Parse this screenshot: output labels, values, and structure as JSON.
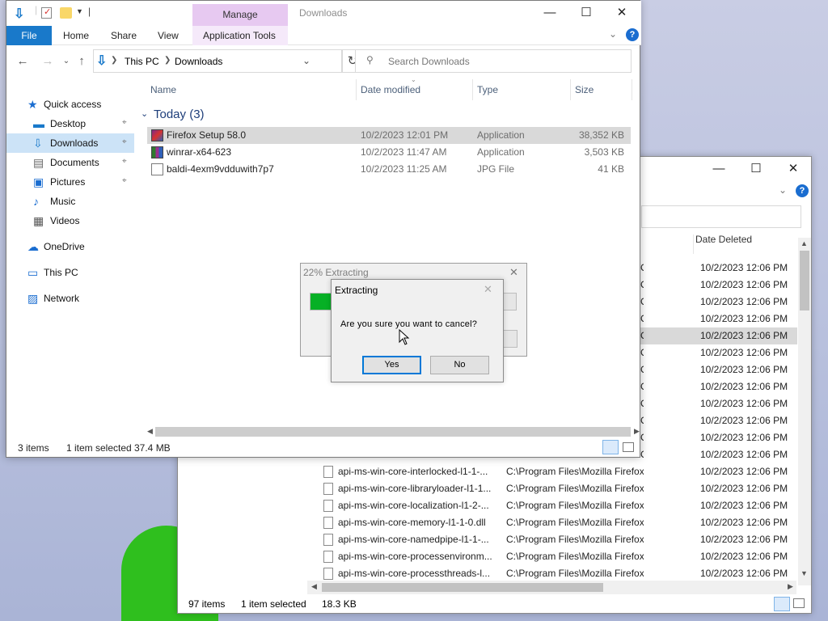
{
  "background_window": {
    "column_date_deleted": "Date Deleted",
    "status": {
      "count": "97 items",
      "selection": "1 item selected",
      "size": "18.3 KB"
    },
    "rows": [
      {
        "name": "",
        "path": "C:\\Program Files\\Mozilla Firefox",
        "date": "10/2/2023 12:06 PM"
      },
      {
        "name": "",
        "path": "C:\\Program Files\\Mozilla Firefox",
        "date": "10/2/2023 12:06 PM"
      },
      {
        "name": "",
        "path": "C:\\Program Files\\Mozilla Firefox",
        "date": "10/2/2023 12:06 PM"
      },
      {
        "name": "",
        "path": "C:\\Program Files\\Mozilla Firefox",
        "date": "10/2/2023 12:06 PM"
      },
      {
        "name": "",
        "path": "C:\\Program Files\\Mozilla Firefox",
        "date": "10/2/2023 12:06 PM"
      },
      {
        "name": "",
        "path": "C:\\Program Files\\Mozilla Firefox",
        "date": "10/2/2023 12:06 PM"
      },
      {
        "name": "",
        "path": "C:\\Program Files\\Mozilla Firefox",
        "date": "10/2/2023 12:06 PM"
      },
      {
        "name": "",
        "path": "C:\\Program Files\\Mozilla Firefox",
        "date": "10/2/2023 12:06 PM"
      },
      {
        "name": "",
        "path": "C:\\Program Files\\Mozilla Firefox",
        "date": "10/2/2023 12:06 PM"
      },
      {
        "name": "",
        "path": "C:\\Program Files\\Mozilla Firefox",
        "date": "10/2/2023 12:06 PM"
      },
      {
        "name": "",
        "path": "C:\\Program Files\\Mozilla Firefox",
        "date": "10/2/2023 12:06 PM"
      },
      {
        "name": "",
        "path": "C:\\Program Files\\Mozilla Firefox",
        "date": "10/2/2023 12:06 PM"
      },
      {
        "name": "api-ms-win-core-interlocked-l1-1-...",
        "path": "C:\\Program Files\\Mozilla Firefox",
        "date": "10/2/2023 12:06 PM"
      },
      {
        "name": "api-ms-win-core-libraryloader-l1-1...",
        "path": "C:\\Program Files\\Mozilla Firefox",
        "date": "10/2/2023 12:06 PM"
      },
      {
        "name": "api-ms-win-core-localization-l1-2-...",
        "path": "C:\\Program Files\\Mozilla Firefox",
        "date": "10/2/2023 12:06 PM"
      },
      {
        "name": "api-ms-win-core-memory-l1-1-0.dll",
        "path": "C:\\Program Files\\Mozilla Firefox",
        "date": "10/2/2023 12:06 PM"
      },
      {
        "name": "api-ms-win-core-namedpipe-l1-1-...",
        "path": "C:\\Program Files\\Mozilla Firefox",
        "date": "10/2/2023 12:06 PM"
      },
      {
        "name": "api-ms-win-core-processenvironm...",
        "path": "C:\\Program Files\\Mozilla Firefox",
        "date": "10/2/2023 12:06 PM"
      },
      {
        "name": "api-ms-win-core-processthreads-l...",
        "path": "C:\\Program Files\\Mozilla Firefox",
        "date": "10/2/2023 12:06 PM"
      }
    ]
  },
  "window": {
    "title": "Downloads",
    "manage_tab": "Manage",
    "ribbon": {
      "file": "File",
      "home": "Home",
      "share": "Share",
      "view": "View",
      "app_tools": "Application Tools"
    },
    "breadcrumb": {
      "this_pc": "This PC",
      "downloads": "Downloads"
    },
    "search_placeholder": "Search Downloads",
    "columns": {
      "name": "Name",
      "date": "Date modified",
      "type": "Type",
      "size": "Size"
    },
    "group": "Today (3)",
    "files": [
      {
        "name": "Firefox Setup 58.0",
        "date": "10/2/2023 12:01 PM",
        "type": "Application",
        "size": "38,352 KB",
        "icon": "firefox-installer-icon"
      },
      {
        "name": "winrar-x64-623",
        "date": "10/2/2023 11:47 AM",
        "type": "Application",
        "size": "3,503 KB",
        "icon": "winrar-icon"
      },
      {
        "name": "baldi-4exm9vdduwith7p7",
        "date": "10/2/2023 11:25 AM",
        "type": "JPG File",
        "size": "41 KB",
        "icon": "image-file-icon"
      }
    ],
    "nav": [
      {
        "label": "Quick access",
        "pinned": false
      },
      {
        "label": "Desktop",
        "pinned": true
      },
      {
        "label": "Downloads",
        "pinned": true
      },
      {
        "label": "Documents",
        "pinned": true
      },
      {
        "label": "Pictures",
        "pinned": true
      },
      {
        "label": "Music",
        "pinned": false
      },
      {
        "label": "Videos",
        "pinned": false
      },
      {
        "label": "OneDrive",
        "pinned": false
      },
      {
        "label": "This PC",
        "pinned": false
      },
      {
        "label": "Network",
        "pinned": false
      }
    ],
    "status": {
      "count": "3 items",
      "selection": "1 item selected",
      "size": "37.4 MB"
    }
  },
  "progress_dialog": {
    "title": "22% Extracting",
    "progress": 0.22
  },
  "confirm_dialog": {
    "title": "Extracting",
    "message": "Are you sure you want to cancel?",
    "yes": "Yes",
    "no": "No"
  },
  "colors": {
    "accent": "#1979ca",
    "manage_tab": "#e7c9f1",
    "selection": "#cce3f7",
    "progress": "#06b025"
  }
}
